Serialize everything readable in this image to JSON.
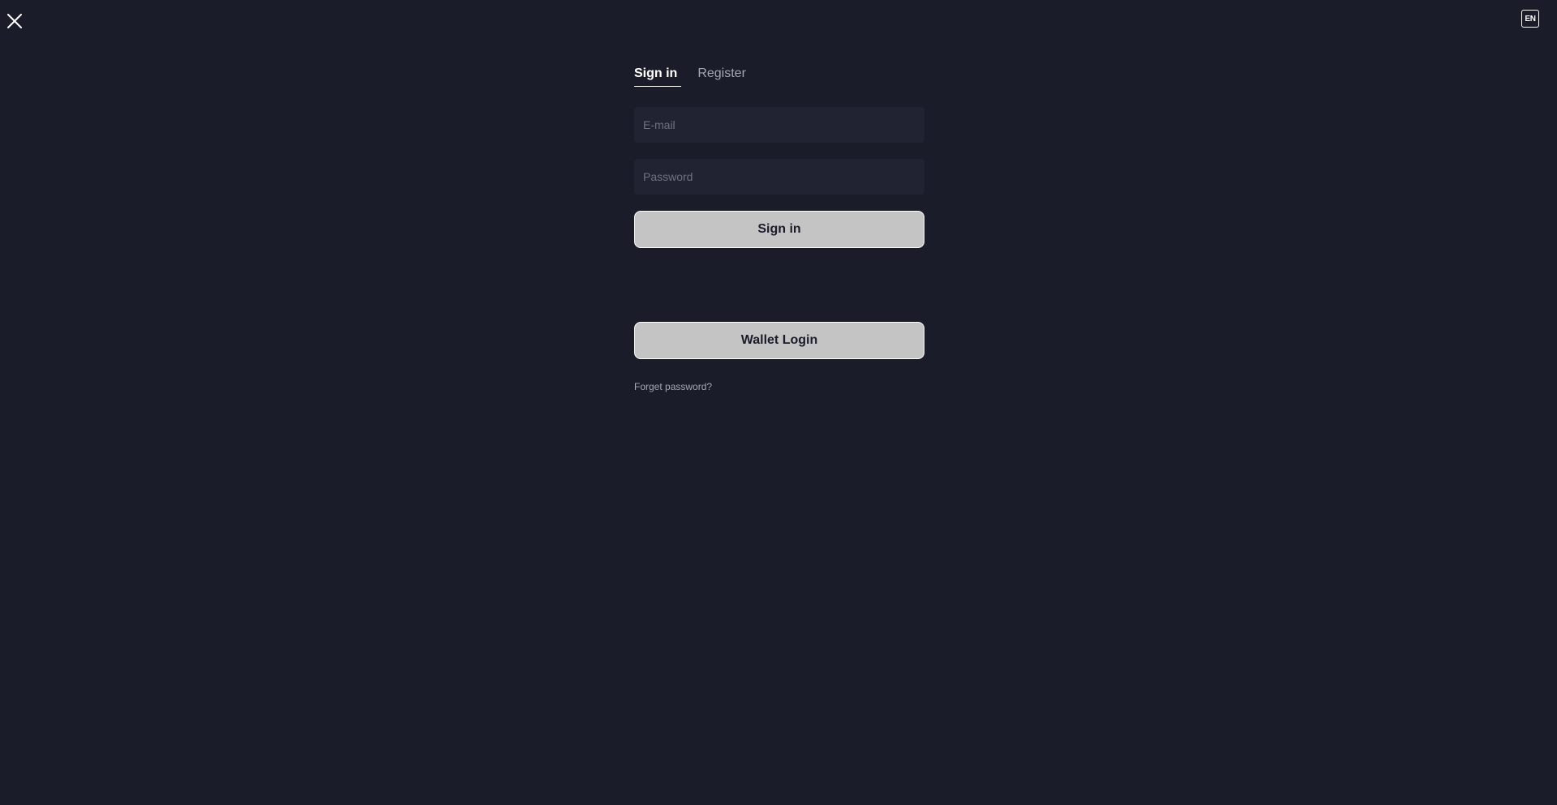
{
  "header": {
    "close_icon": "close-icon",
    "language_label": "EN"
  },
  "tabs": [
    {
      "label": "Sign in",
      "active": true
    },
    {
      "label": "Register",
      "active": false
    }
  ],
  "form": {
    "email": {
      "placeholder": "E-mail",
      "value": ""
    },
    "password": {
      "placeholder": "Password",
      "value": ""
    },
    "signin_label": "Sign in",
    "wallet_label": "Wallet Login",
    "forgot_label": "Forget password?"
  },
  "colors": {
    "background": "#1b1c29",
    "input_background": "#222332",
    "button_background": "#c4c4c4",
    "text_primary": "#ffffff",
    "text_muted": "#a4a6b2"
  }
}
